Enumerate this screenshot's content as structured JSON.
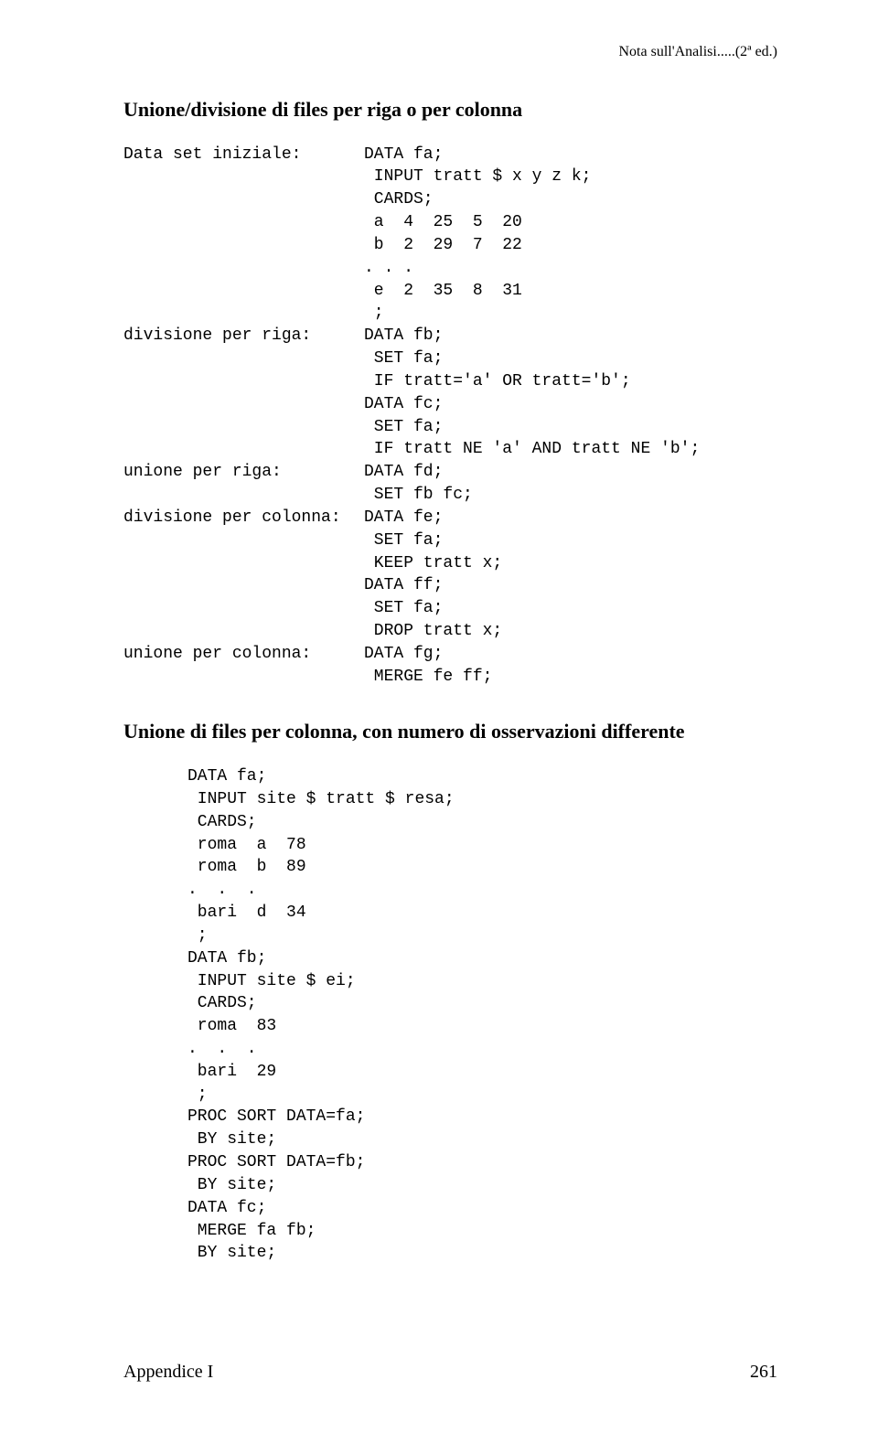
{
  "running_header": "Nota sull'Analisi.....(2ª ed.)",
  "sec1": {
    "heading": "Unione/divisione di files per riga o per colonna",
    "rows": [
      {
        "label": "Data set iniziale:",
        "code": "DATA fa;"
      },
      {
        "label": "",
        "code": " INPUT tratt $ x y z k;"
      },
      {
        "label": "",
        "code": " CARDS;"
      },
      {
        "label": "",
        "code": " a  4  25  5  20"
      },
      {
        "label": "",
        "code": " b  2  29  7  22"
      },
      {
        "label": "",
        "code": ". . ."
      },
      {
        "label": "",
        "code": " e  2  35  8  31"
      },
      {
        "label": "",
        "code": " ;"
      },
      {
        "label": "divisione per riga:",
        "code": "DATA fb;"
      },
      {
        "label": "",
        "code": " SET fa;"
      },
      {
        "label": "",
        "code": " IF tratt='a' OR tratt='b';"
      },
      {
        "label": "",
        "code": "DATA fc;"
      },
      {
        "label": "",
        "code": " SET fa;"
      },
      {
        "label": "",
        "code": " IF tratt NE 'a' AND tratt NE 'b';"
      },
      {
        "label": "unione per riga:",
        "code": "DATA fd;"
      },
      {
        "label": "",
        "code": " SET fb fc;"
      },
      {
        "label": "divisione per colonna:",
        "code": "DATA fe;"
      },
      {
        "label": "",
        "code": " SET fa;"
      },
      {
        "label": "",
        "code": " KEEP tratt x;"
      },
      {
        "label": "",
        "code": "DATA ff;"
      },
      {
        "label": "",
        "code": " SET fa;"
      },
      {
        "label": "",
        "code": " DROP tratt x;"
      },
      {
        "label": "unione per colonna:",
        "code": "DATA fg;"
      },
      {
        "label": "",
        "code": " MERGE fe ff;"
      }
    ]
  },
  "sec2": {
    "heading": "Unione di files per colonna, con numero di osservazioni differente",
    "code": "DATA fa;\n INPUT site $ tratt $ resa;\n CARDS;\n roma  a  78\n roma  b  89\n.  .  .\n bari  d  34\n ;\nDATA fb;\n INPUT site $ ei;\n CARDS;\n roma  83\n.  .  .\n bari  29\n ;\nPROC SORT DATA=fa;\n BY site;\nPROC SORT DATA=fb;\n BY site;\nDATA fc;\n MERGE fa fb;\n BY site;"
  },
  "footer": {
    "left": "Appendice I",
    "right": "261"
  }
}
